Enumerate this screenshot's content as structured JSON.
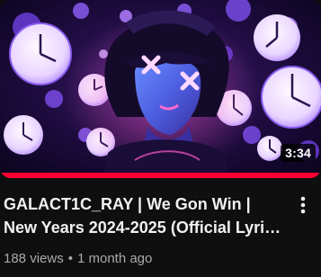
{
  "video": {
    "duration": "3:34",
    "title": "GALACT1C_RAY | We Gon Win | New Years 2024-2025 (Official Lyric Video)",
    "views": "188 views",
    "separator": "•",
    "age": "1 month ago",
    "watched_fraction": 1.0,
    "menu_icon": "more-vert-icon",
    "thumbnail_icon": "clock-pattern-portrait"
  },
  "colors": {
    "background": "#0f0f0f",
    "title": "#f1f1f1",
    "meta": "#aaaaaa",
    "progress": "#ff0033",
    "accent_purple": "#7a3cff",
    "accent_pink": "#ff5ac8"
  }
}
